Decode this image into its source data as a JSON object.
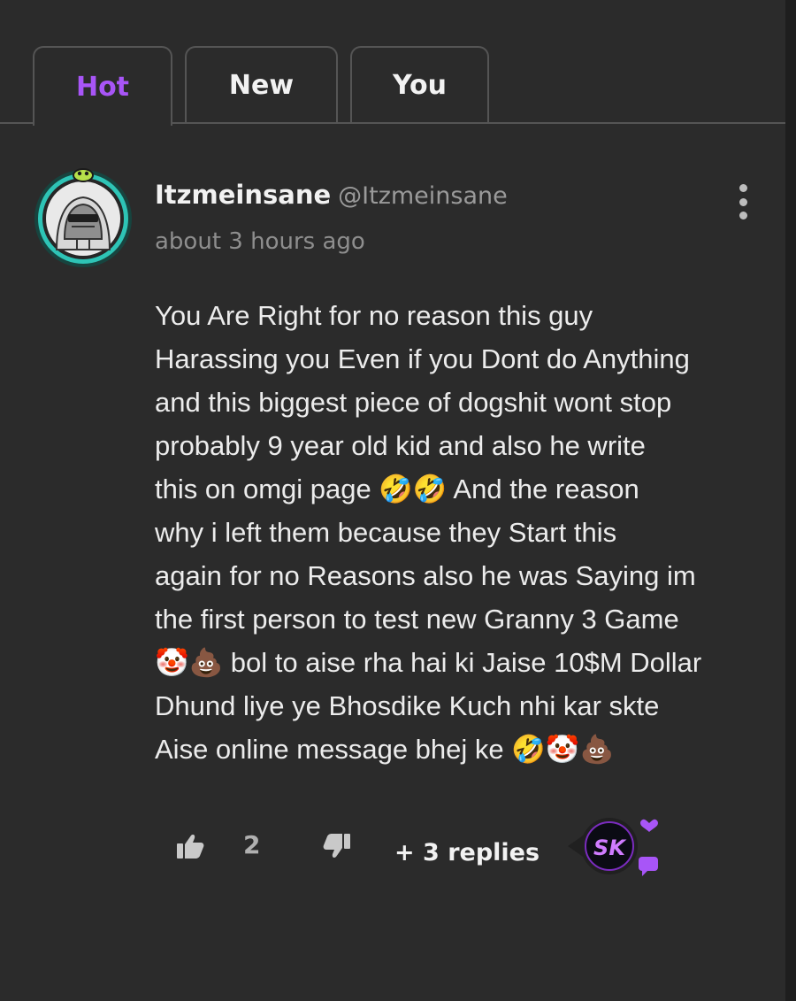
{
  "tabs": [
    {
      "label": "Hot",
      "active": true
    },
    {
      "label": "New",
      "active": false
    },
    {
      "label": "You",
      "active": false
    }
  ],
  "comment": {
    "author": "Itzmeinsane",
    "handle": "@Itzmeinsane",
    "timestamp": "about 3 hours ago",
    "body": "You Are Right for no reason this guy\nHarassing you Even if you Dont do Anything\nand this biggest piece of dogshit wont stop\nprobably 9 year old kid and also he write\nthis on omgi page 🤣🤣 And the reason\nwhy i left them because they Start this\nagain for no Reasons also he was Saying im\nthe first person to test new Granny 3 Game\n🤡💩 bol to aise rha hai ki Jaise 10$M Dollar\nDhund liye ye Bhosdike Kuch nhi kar skte\nAise online message bhej ke 🤣🤡💩",
    "like_count": "2",
    "replies_label": "+ 3 replies",
    "reply_avatar_text": "SK"
  },
  "icons": {
    "more": "more-vertical-icon",
    "like": "thumbs-up-icon",
    "dislike": "thumbs-down-icon"
  },
  "colors": {
    "accent": "#a855f7",
    "background": "#2b2b2b",
    "avatar_ring": "#2ec4b6"
  }
}
